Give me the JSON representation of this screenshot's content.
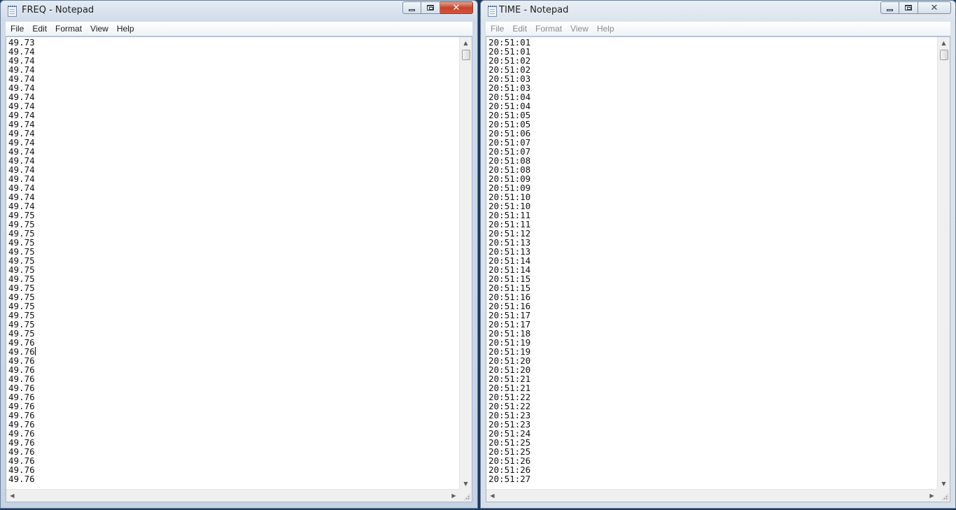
{
  "windows": [
    {
      "title": "FREQ - Notepad",
      "active": true,
      "menu": [
        "File",
        "Edit",
        "Format",
        "View",
        "Help"
      ],
      "caret_line": 34,
      "lines": [
        "49.73",
        "49.74",
        "49.74",
        "49.74",
        "49.74",
        "49.74",
        "49.74",
        "49.74",
        "49.74",
        "49.74",
        "49.74",
        "49.74",
        "49.74",
        "49.74",
        "49.74",
        "49.74",
        "49.74",
        "49.74",
        "49.74",
        "49.75",
        "49.75",
        "49.75",
        "49.75",
        "49.75",
        "49.75",
        "49.75",
        "49.75",
        "49.75",
        "49.75",
        "49.75",
        "49.75",
        "49.75",
        "49.75",
        "49.76",
        "49.76",
        "49.76",
        "49.76",
        "49.76",
        "49.76",
        "49.76",
        "49.76",
        "49.76",
        "49.76",
        "49.76",
        "49.76",
        "49.76",
        "49.76",
        "49.76",
        "49.76"
      ]
    },
    {
      "title": "TIME - Notepad",
      "active": false,
      "menu": [
        "File",
        "Edit",
        "Format",
        "View",
        "Help"
      ],
      "caret_line": -1,
      "lines": [
        "20:51:01",
        "20:51:01",
        "20:51:02",
        "20:51:02",
        "20:51:03",
        "20:51:03",
        "20:51:04",
        "20:51:04",
        "20:51:05",
        "20:51:05",
        "20:51:06",
        "20:51:07",
        "20:51:07",
        "20:51:08",
        "20:51:08",
        "20:51:09",
        "20:51:09",
        "20:51:10",
        "20:51:10",
        "20:51:11",
        "20:51:11",
        "20:51:12",
        "20:51:13",
        "20:51:13",
        "20:51:14",
        "20:51:14",
        "20:51:15",
        "20:51:15",
        "20:51:16",
        "20:51:16",
        "20:51:17",
        "20:51:17",
        "20:51:18",
        "20:51:19",
        "20:51:19",
        "20:51:20",
        "20:51:20",
        "20:51:21",
        "20:51:21",
        "20:51:22",
        "20:51:22",
        "20:51:23",
        "20:51:23",
        "20:51:24",
        "20:51:25",
        "20:51:25",
        "20:51:26",
        "20:51:26",
        "20:51:27"
      ]
    }
  ],
  "icons": {
    "app": "notepad-icon",
    "minimize": "minimize-icon",
    "maximize": "maximize-icon",
    "close": "close-icon",
    "scroll_up": "chevron-up-icon",
    "scroll_down": "chevron-down-icon",
    "scroll_left": "chevron-left-icon",
    "scroll_right": "chevron-right-icon"
  },
  "colors": {
    "desktop": "#1b3a63",
    "close_active": "#c7442c"
  }
}
